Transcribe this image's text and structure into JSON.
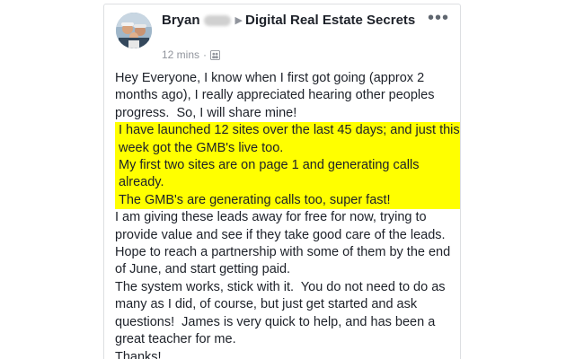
{
  "post": {
    "author_first": "Bryan",
    "group_name": "Digital Real Estate Secrets",
    "time_ago": "12 mins",
    "separator": "·",
    "audience_icon": "group-audience-icon",
    "menu_icon": "more-options-icon",
    "paragraphs": [
      {
        "text": "Hey Everyone, I know when I first got going (approx 2 months ago), I really appreciated hearing other peoples progress.  So, I will share mine!",
        "highlighted": false
      },
      {
        "text": "I have launched 12 sites over the last 45 days; and just this week got the GMB's live too.",
        "highlighted": true
      },
      {
        "text": "My first two sites are on page 1 and generating calls already.",
        "highlighted": true
      },
      {
        "text": "The GMB's are generating calls too, super fast!",
        "highlighted": true
      },
      {
        "text": "I am giving these leads away for free for now, trying to provide value and see if they take good care of the leads.  Hope to reach a partnership with some of them by the end of June, and start getting paid.",
        "highlighted": false
      },
      {
        "text": "The system works, stick with it.  You do not need to do as many as I did, of course, but just get started and ask questions!  James is very quick to help, and has been a great teacher for me.",
        "highlighted": false
      },
      {
        "text": "Thanks!",
        "highlighted": false
      }
    ]
  },
  "colors": {
    "highlight": "#ffff00",
    "text": "#1d2129",
    "muted": "#90949c",
    "border": "#dddfe2"
  }
}
